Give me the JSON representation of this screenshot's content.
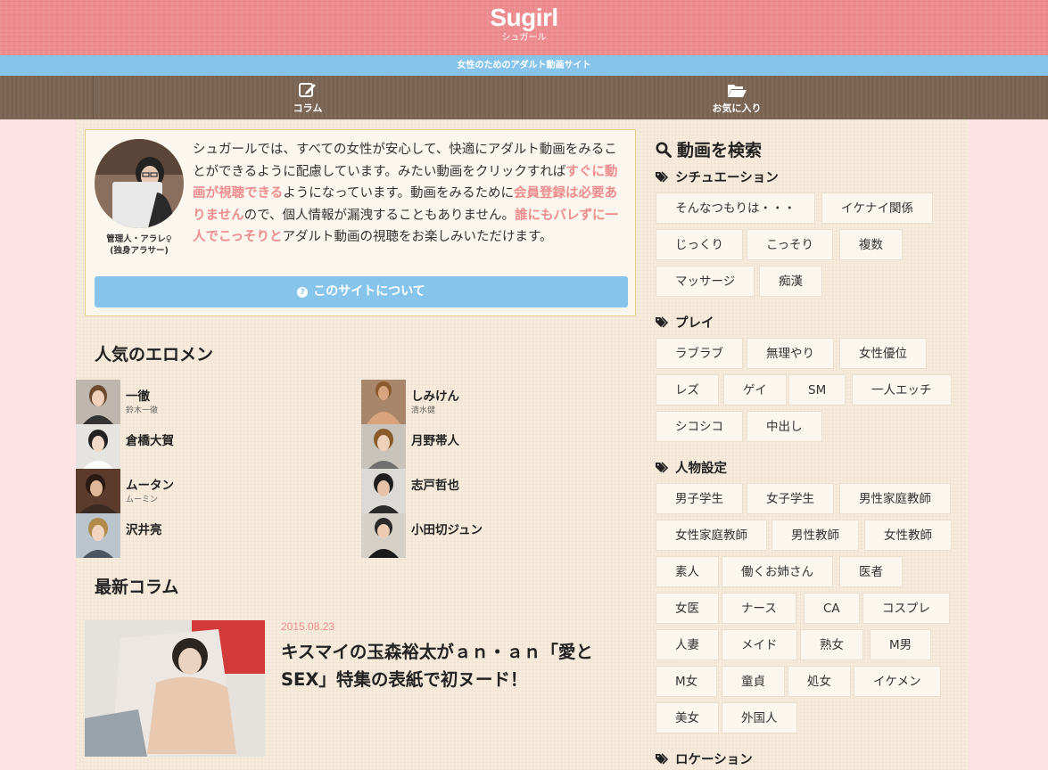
{
  "header": {
    "logo": "Sugirl",
    "logo_sub": "シュガール",
    "tagline": "女性のためのアダルト動画サイト"
  },
  "nav": [
    {
      "label": "コラム",
      "icon": "edit-icon"
    },
    {
      "label": "お気に入り",
      "icon": "folder-open-icon"
    }
  ],
  "intro": {
    "admin_name": "管理人・アラレ♀",
    "admin_note": "(独身アラサー)",
    "text_1": "シュガールでは、すべての女性が安心して、快適にアダルト動画をみることができるように配慮しています。みたい動画をクリックすれば",
    "hl_1": "すぐに動画が視聴できる",
    "text_2": "ようになっています。動画をみるために",
    "hl_2": "会員登録は必要ありません",
    "text_3": "ので、個人情報が漏洩することもありません。",
    "hl_3": "誰にもバレずに一人でこっそりと",
    "text_4": "アダルト動画の視聴をお楽しみいただけます。",
    "about_button": "このサイトについて"
  },
  "popular": {
    "title": "人気のエロメン",
    "men": [
      {
        "name": "一徹",
        "sub": "鈴木一徹"
      },
      {
        "name": "しみけん",
        "sub": "清水健"
      },
      {
        "name": "倉橋大賀",
        "sub": ""
      },
      {
        "name": "月野帯人",
        "sub": ""
      },
      {
        "name": "ムータン",
        "sub": "ムーミン"
      },
      {
        "name": "志戸哲也",
        "sub": ""
      },
      {
        "name": "沢井亮",
        "sub": ""
      },
      {
        "name": "小田切ジュン",
        "sub": ""
      }
    ]
  },
  "columns": {
    "title": "最新コラム",
    "items": [
      {
        "date": "2015.08.23",
        "title": "キスマイの玉森裕太がａｎ・ａｎ「愛とSEX」特集の表紙で初ヌード！"
      }
    ]
  },
  "sidebar": {
    "search_title": "動画を検索",
    "categories": [
      {
        "title": "シチュエーション",
        "tags": [
          "そんなつもりは・・・",
          "イケナイ関係",
          "じっくり",
          "こっそり",
          "複数",
          "マッサージ",
          "痴漢"
        ]
      },
      {
        "title": "プレイ",
        "tags": [
          "ラブラブ",
          "無理やり",
          "女性優位",
          "レズ",
          "ゲイ",
          "SM",
          "一人エッチ",
          "シコシコ",
          "中出し"
        ]
      },
      {
        "title": "人物設定",
        "tags": [
          "男子学生",
          "女子学生",
          "男性家庭教師",
          "女性家庭教師",
          "男性教師",
          "女性教師",
          "素人",
          "働くお姉さん",
          "医者",
          "女医",
          "ナース",
          "CA",
          "コスプレ",
          "人妻",
          "メイド",
          "熟女",
          "M男",
          "M女",
          "童貞",
          "処女",
          "イケメン",
          "美女",
          "外国人"
        ]
      },
      {
        "title": "ロケーション",
        "tags": []
      }
    ]
  },
  "colors": {
    "pink": "#ee8b8e",
    "blue": "#86c4ec",
    "brown": "#7a6351"
  }
}
